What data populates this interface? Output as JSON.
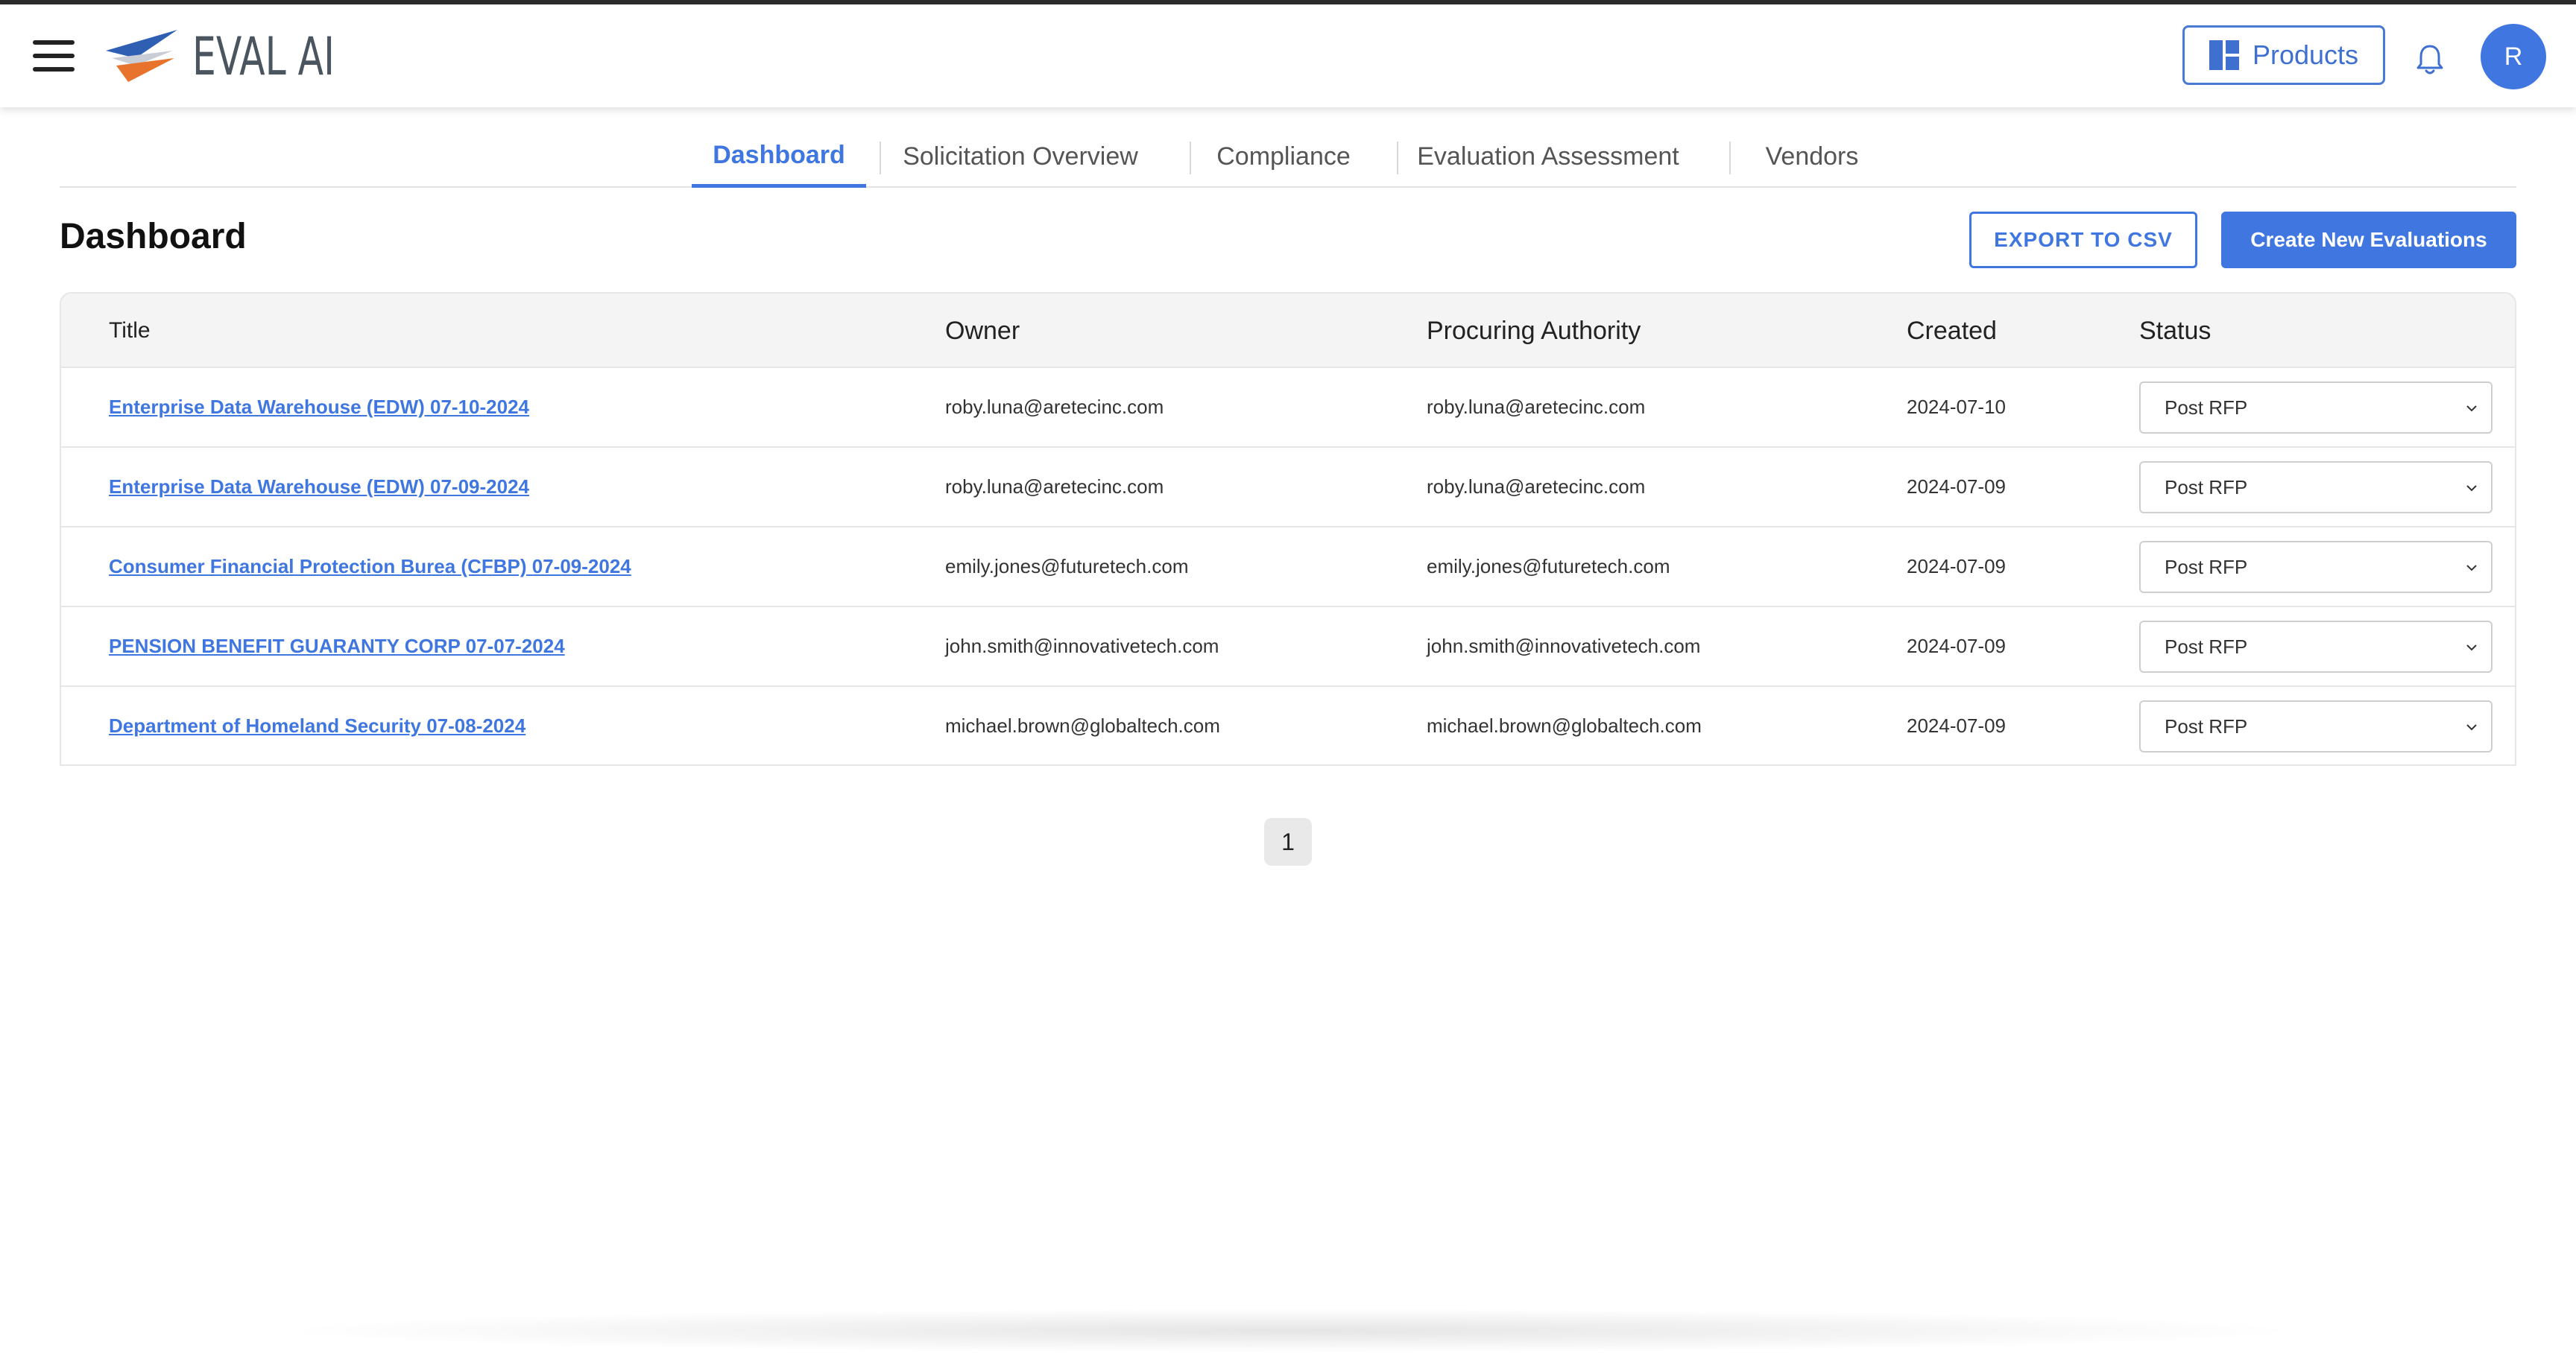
{
  "app": {
    "logo_text": "EVAL AI",
    "accent": "#3f76e0"
  },
  "header": {
    "products_label": "Products",
    "avatar_initial": "R"
  },
  "tabs": [
    {
      "label": "Dashboard",
      "active": true
    },
    {
      "label": "Solicitation Overview",
      "active": false
    },
    {
      "label": "Compliance",
      "active": false
    },
    {
      "label": "Evaluation Assessment",
      "active": false
    },
    {
      "label": "Vendors",
      "active": false
    }
  ],
  "page": {
    "title": "Dashboard",
    "export_label": "EXPORT TO CSV",
    "create_label": "Create New Evaluations"
  },
  "table": {
    "columns": [
      "Title",
      "Owner",
      "Procuring Authority",
      "Created",
      "Status"
    ],
    "rows": [
      {
        "title": "Enterprise Data Warehouse (EDW) 07-10-2024",
        "owner": "roby.luna@aretecinc.com",
        "authority": "roby.luna@aretecinc.com",
        "created": "2024-07-10",
        "status": "Post RFP"
      },
      {
        "title": "Enterprise Data Warehouse (EDW) 07-09-2024",
        "owner": "roby.luna@aretecinc.com",
        "authority": "roby.luna@aretecinc.com",
        "created": "2024-07-09",
        "status": "Post RFP"
      },
      {
        "title": "Consumer Financial Protection Burea (CFBP) 07-09-2024",
        "owner": "emily.jones@futuretech.com",
        "authority": "emily.jones@futuretech.com",
        "created": "2024-07-09",
        "status": "Post RFP"
      },
      {
        "title": "PENSION BENEFIT GUARANTY CORP 07-07-2024",
        "owner": "john.smith@innovativetech.com",
        "authority": "john.smith@innovativetech.com",
        "created": "2024-07-09",
        "status": "Post RFP"
      },
      {
        "title": "Department of Homeland Security 07-08-2024",
        "owner": "michael.brown@globaltech.com",
        "authority": "michael.brown@globaltech.com",
        "created": "2024-07-09",
        "status": "Post RFP"
      }
    ]
  },
  "pagination": {
    "current_page": "1"
  }
}
